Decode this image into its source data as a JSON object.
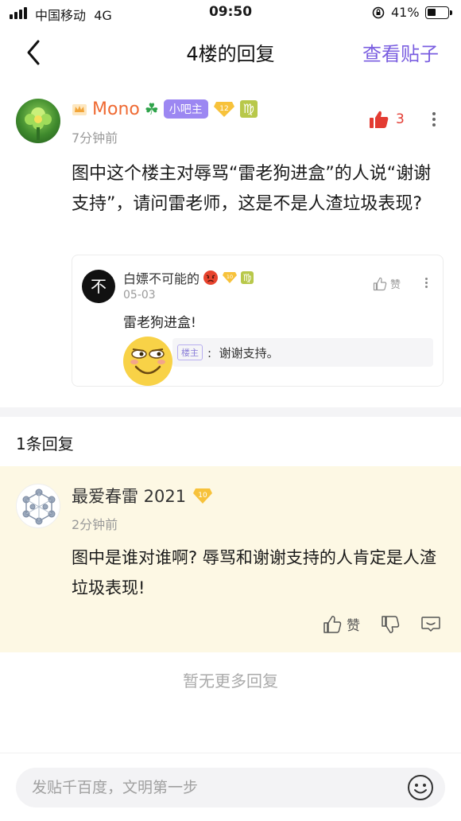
{
  "status_bar": {
    "carrier": "中国移动",
    "network": "4G",
    "time": "09:50",
    "battery": "41%"
  },
  "nav": {
    "title": "4楼的回复",
    "view_post": "查看贴子"
  },
  "post": {
    "username": "Mono",
    "admin_badge": "小吧主",
    "level": "12",
    "time": "7分钟前",
    "like_count": "3",
    "text": "图中这个楼主对辱骂“雷老狗进盒”的人说“谢谢支持”，请问雷老师，这是不是人渣垃圾表现?",
    "quote": {
      "avatar_char": "不",
      "name": "白嫖不可能的",
      "level": "10",
      "time": "05-03",
      "like_label": "赞",
      "text": "雷老狗进盒!",
      "reply_tag": "楼主",
      "reply_text": "谢谢支持。"
    }
  },
  "reply_count": "1条回复",
  "reply": {
    "username": "最爱春雷 2021",
    "level": "10",
    "time": "2分钟前",
    "text": "图中是谁对谁啊? 辱骂和谢谢支持的人肯定是人渣垃圾表现!",
    "like_label": "赞"
  },
  "no_more": "暂无更多回复",
  "input": {
    "placeholder": "发贴千百度，文明第一步"
  },
  "colors": {
    "accent": "#7a5ee0",
    "username": "#ef6a33",
    "like": "#e33b32",
    "reply_bg": "#fdf8e4"
  }
}
